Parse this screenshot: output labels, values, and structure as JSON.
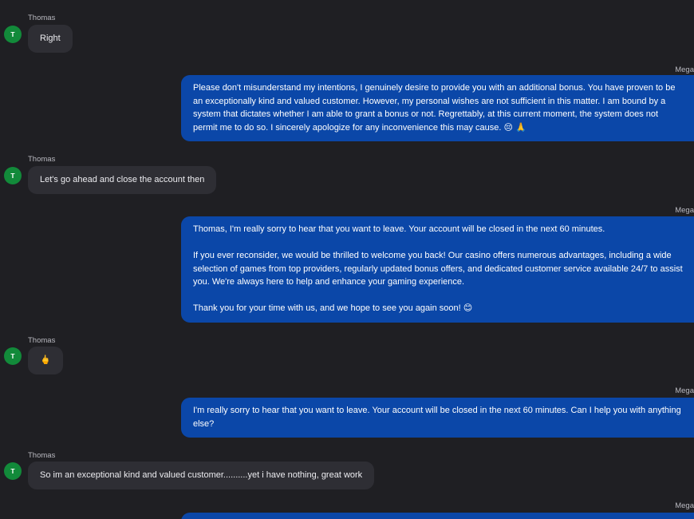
{
  "messages": [
    {
      "sender": "Thomas",
      "avatar_letter": "T",
      "direction": "incoming",
      "paragraphs": [
        "Right"
      ]
    },
    {
      "sender": "Mega",
      "direction": "outgoing",
      "paragraphs": [
        "Please don't misunderstand my intentions, I genuinely desire to provide you with an additional bonus. You have proven to be an exceptionally kind and valued customer. However, my personal wishes are not sufficient in this matter. I am bound by a system that dictates whether I am able to grant a bonus or not. Regrettably, at this current moment, the system does not permit me to do so. I sincerely apologize for any inconvenience this may cause. 😔 🙏"
      ]
    },
    {
      "sender": "Thomas",
      "avatar_letter": "T",
      "direction": "incoming",
      "paragraphs": [
        "Let's go ahead and close the account then"
      ]
    },
    {
      "sender": "Mega",
      "direction": "outgoing",
      "paragraphs": [
        "Thomas, I'm really sorry to hear that you want to leave. Your account will be closed in the next 60 minutes.",
        "If you ever reconsider, we would be thrilled to welcome you back! Our casino offers numerous advantages, including a wide selection of games from top providers, regularly updated bonus offers, and dedicated customer service available 24/7 to assist you. We're always here to help and enhance your gaming experience.",
        "Thank you for your time with us, and we hope to see you again soon! 😊"
      ]
    },
    {
      "sender": "Thomas",
      "avatar_letter": "T",
      "direction": "incoming",
      "paragraphs": [
        "🖕"
      ]
    },
    {
      "sender": "Mega",
      "direction": "outgoing",
      "paragraphs": [
        "I'm really sorry to hear that you want to leave. Your account will be closed in the next 60 minutes. Can I help you with anything else?"
      ]
    },
    {
      "sender": "Thomas",
      "avatar_letter": "T",
      "direction": "incoming",
      "paragraphs": [
        "So im an exceptional kind and valued customer..........yet i have nothing, great work"
      ]
    },
    {
      "sender": "Mega",
      "direction": "outgoing",
      "paragraphs": []
    }
  ]
}
